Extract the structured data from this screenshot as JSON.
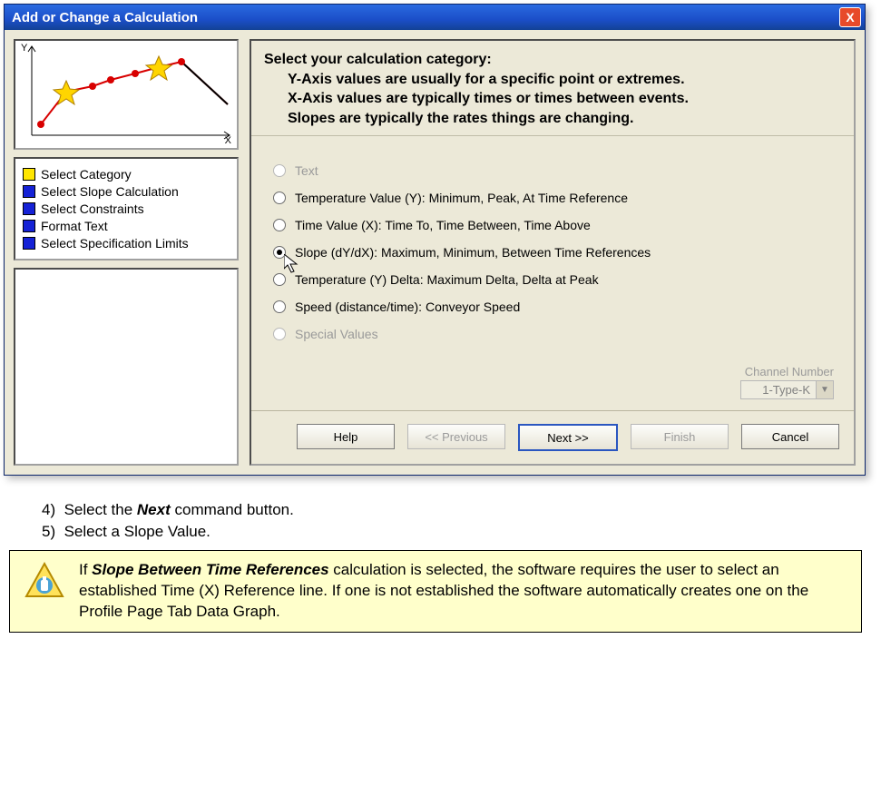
{
  "dialog": {
    "title": "Add or Change a Calculation",
    "close_label": "X",
    "axis_y": "Y",
    "axis_x": "X"
  },
  "sidebar": {
    "items": [
      {
        "label": "Select Category",
        "color": "y"
      },
      {
        "label": "Select Slope Calculation",
        "color": "b"
      },
      {
        "label": "Select Constraints",
        "color": "b"
      },
      {
        "label": "Format Text",
        "color": "b"
      },
      {
        "label": "Select Specification Limits",
        "color": "b"
      }
    ]
  },
  "heading": {
    "line1": "Select your calculation category:",
    "line2": "Y-Axis values are usually for a specific point or extremes.",
    "line3": "X-Axis values are typically times or times between events.",
    "line4": "Slopes are typically the rates things are changing."
  },
  "options": [
    {
      "label": "Text",
      "disabled": true,
      "checked": false
    },
    {
      "label": "Temperature Value (Y):  Minimum, Peak, At Time Reference",
      "disabled": false,
      "checked": false
    },
    {
      "label": "Time Value (X):  Time To, Time Between, Time Above",
      "disabled": false,
      "checked": false
    },
    {
      "label": "Slope (dY/dX):  Maximum, Minimum, Between Time References",
      "disabled": false,
      "checked": true
    },
    {
      "label": "Temperature (Y) Delta:  Maximum Delta, Delta at Peak",
      "disabled": false,
      "checked": false
    },
    {
      "label": "Speed (distance/time): Conveyor Speed",
      "disabled": false,
      "checked": false
    },
    {
      "label": "Special  Values",
      "disabled": true,
      "checked": false
    }
  ],
  "channel": {
    "label": "Channel Number",
    "value": "1-Type-K"
  },
  "buttons": {
    "help": "Help",
    "prev": "<< Previous",
    "next": "Next >>",
    "finish": "Finish",
    "cancel": "Cancel"
  },
  "instructions": {
    "step4_num": "4)",
    "step4_pre": "Select the ",
    "step4_bold": "Next",
    "step4_post": " command button.",
    "step5_num": "5)",
    "step5": "Select a Slope Value."
  },
  "note": {
    "pre": "If ",
    "bold": "Slope Between Time References",
    "post": " calculation is selected, the software requires the user to select an established Time (X) Reference line. If one is not established the software automatically creates one on the Profile Page Tab Data Graph."
  },
  "chart_data": {
    "type": "line",
    "title": "",
    "xlabel": "X",
    "ylabel": "Y",
    "xlim": [
      0,
      240
    ],
    "ylim": [
      0,
      100
    ],
    "series": [
      {
        "name": "curve",
        "x": [
          20,
          50,
          80,
          100,
          130,
          155,
          180,
          235
        ],
        "y": [
          22,
          55,
          60,
          68,
          75,
          82,
          88,
          45
        ]
      }
    ],
    "markers": [
      {
        "kind": "star",
        "x": 50,
        "y": 55
      },
      {
        "kind": "star",
        "x": 155,
        "y": 82
      }
    ]
  }
}
